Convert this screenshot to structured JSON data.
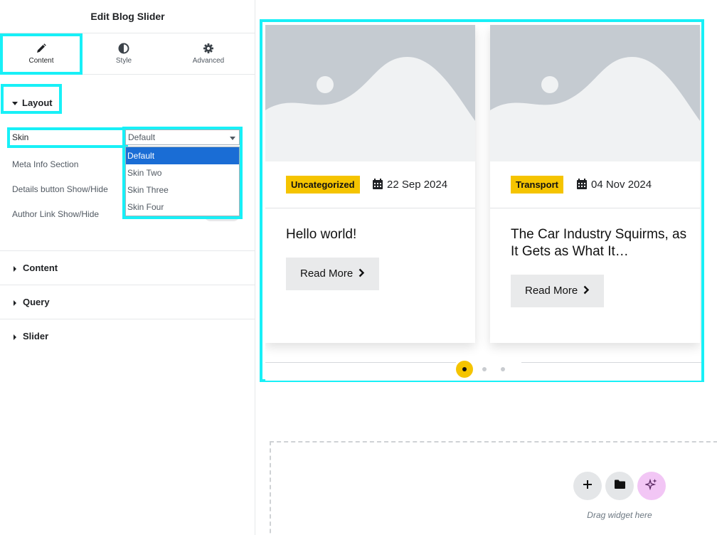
{
  "panel": {
    "title": "Edit Blog Slider",
    "tabs": [
      {
        "label": "Content",
        "icon": "pencil-icon",
        "active": true
      },
      {
        "label": "Style",
        "icon": "half-circle-icon",
        "active": false
      },
      {
        "label": "Advanced",
        "icon": "gear-icon",
        "active": false
      }
    ],
    "layout_section": {
      "label": "Layout",
      "controls": {
        "skin_label": "Skin",
        "skin_value": "Default",
        "skin_options": [
          "Default",
          "Skin Two",
          "Skin Three",
          "Skin Four"
        ],
        "meta_info_label": "Meta Info Section",
        "details_button_label": "Details button Show/Hide",
        "author_link_label": "Author Link Show/Hide"
      }
    },
    "collapsed_sections": [
      "Content",
      "Query",
      "Slider"
    ]
  },
  "slider": {
    "cards": [
      {
        "category": "Uncategorized",
        "date": "22 Sep 2024",
        "title": "Hello world!",
        "button": "Read More"
      },
      {
        "category": "Transport",
        "date": "04 Nov 2024",
        "title": "The Car Industry Squirms, as It Gets as What It…",
        "button": "Read More"
      }
    ],
    "pagination": {
      "count": 3,
      "active": 1
    }
  },
  "dropzone": {
    "hint": "Drag widget here",
    "buttons": [
      "add-icon",
      "folder-icon",
      "ai-sparkle-icon"
    ]
  },
  "colors": {
    "accent_highlight": "#18f0f7",
    "badge": "#f5c400",
    "dropdown_selected": "#1a6dd5",
    "ai_button": "#f2c6f5"
  }
}
